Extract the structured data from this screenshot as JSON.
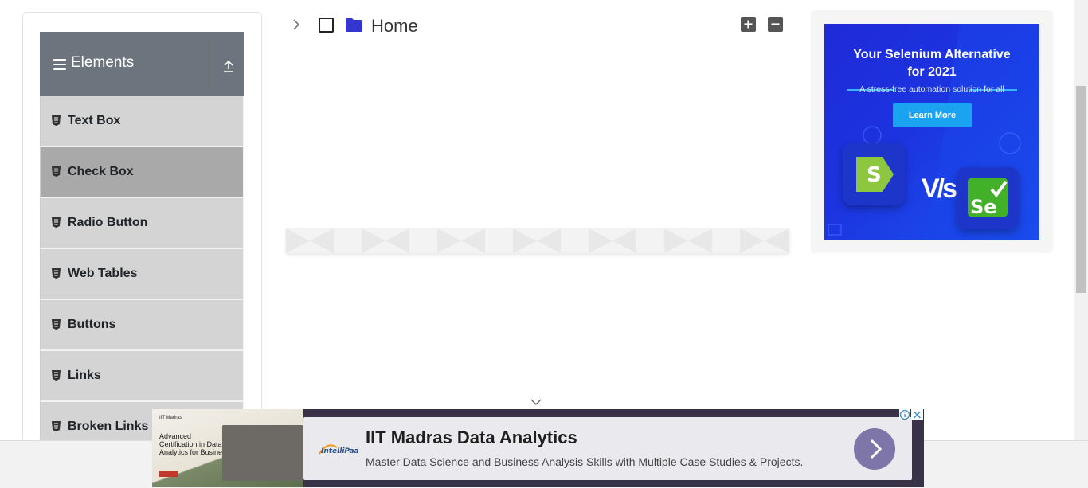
{
  "sidebar": {
    "group_title": "Elements",
    "items": [
      {
        "label": "Text Box"
      },
      {
        "label": "Check Box"
      },
      {
        "label": "Radio Button"
      },
      {
        "label": "Web Tables"
      },
      {
        "label": "Buttons"
      },
      {
        "label": "Links"
      },
      {
        "label": "Broken Links -"
      }
    ],
    "active_item": "Check Box"
  },
  "tree": {
    "root_label": "Home",
    "folder_color": "#3535d0",
    "expand_all_icon": "plus-square-icon",
    "collapse_all_icon": "minus-square-icon"
  },
  "side_ad": {
    "headline_line1": "Your Selenium Alternative",
    "headline_line2": "for 2021",
    "subtext": "A stress-free automation solution for all",
    "cta": "Learn More",
    "vs_text": "V/s",
    "logo_left": "S",
    "logo_right": "Se"
  },
  "banner_ad": {
    "thumb_badge": "IIT Madras",
    "thumb_title": "Advanced Certification in Data Analytics for Business",
    "brand": "IntelliPaat",
    "title": "IIT Madras Data Analytics",
    "description": "Master Data Science and Business Analysis Skills with Multiple Case Studies & Projects.",
    "accent": "#7e75a8"
  }
}
